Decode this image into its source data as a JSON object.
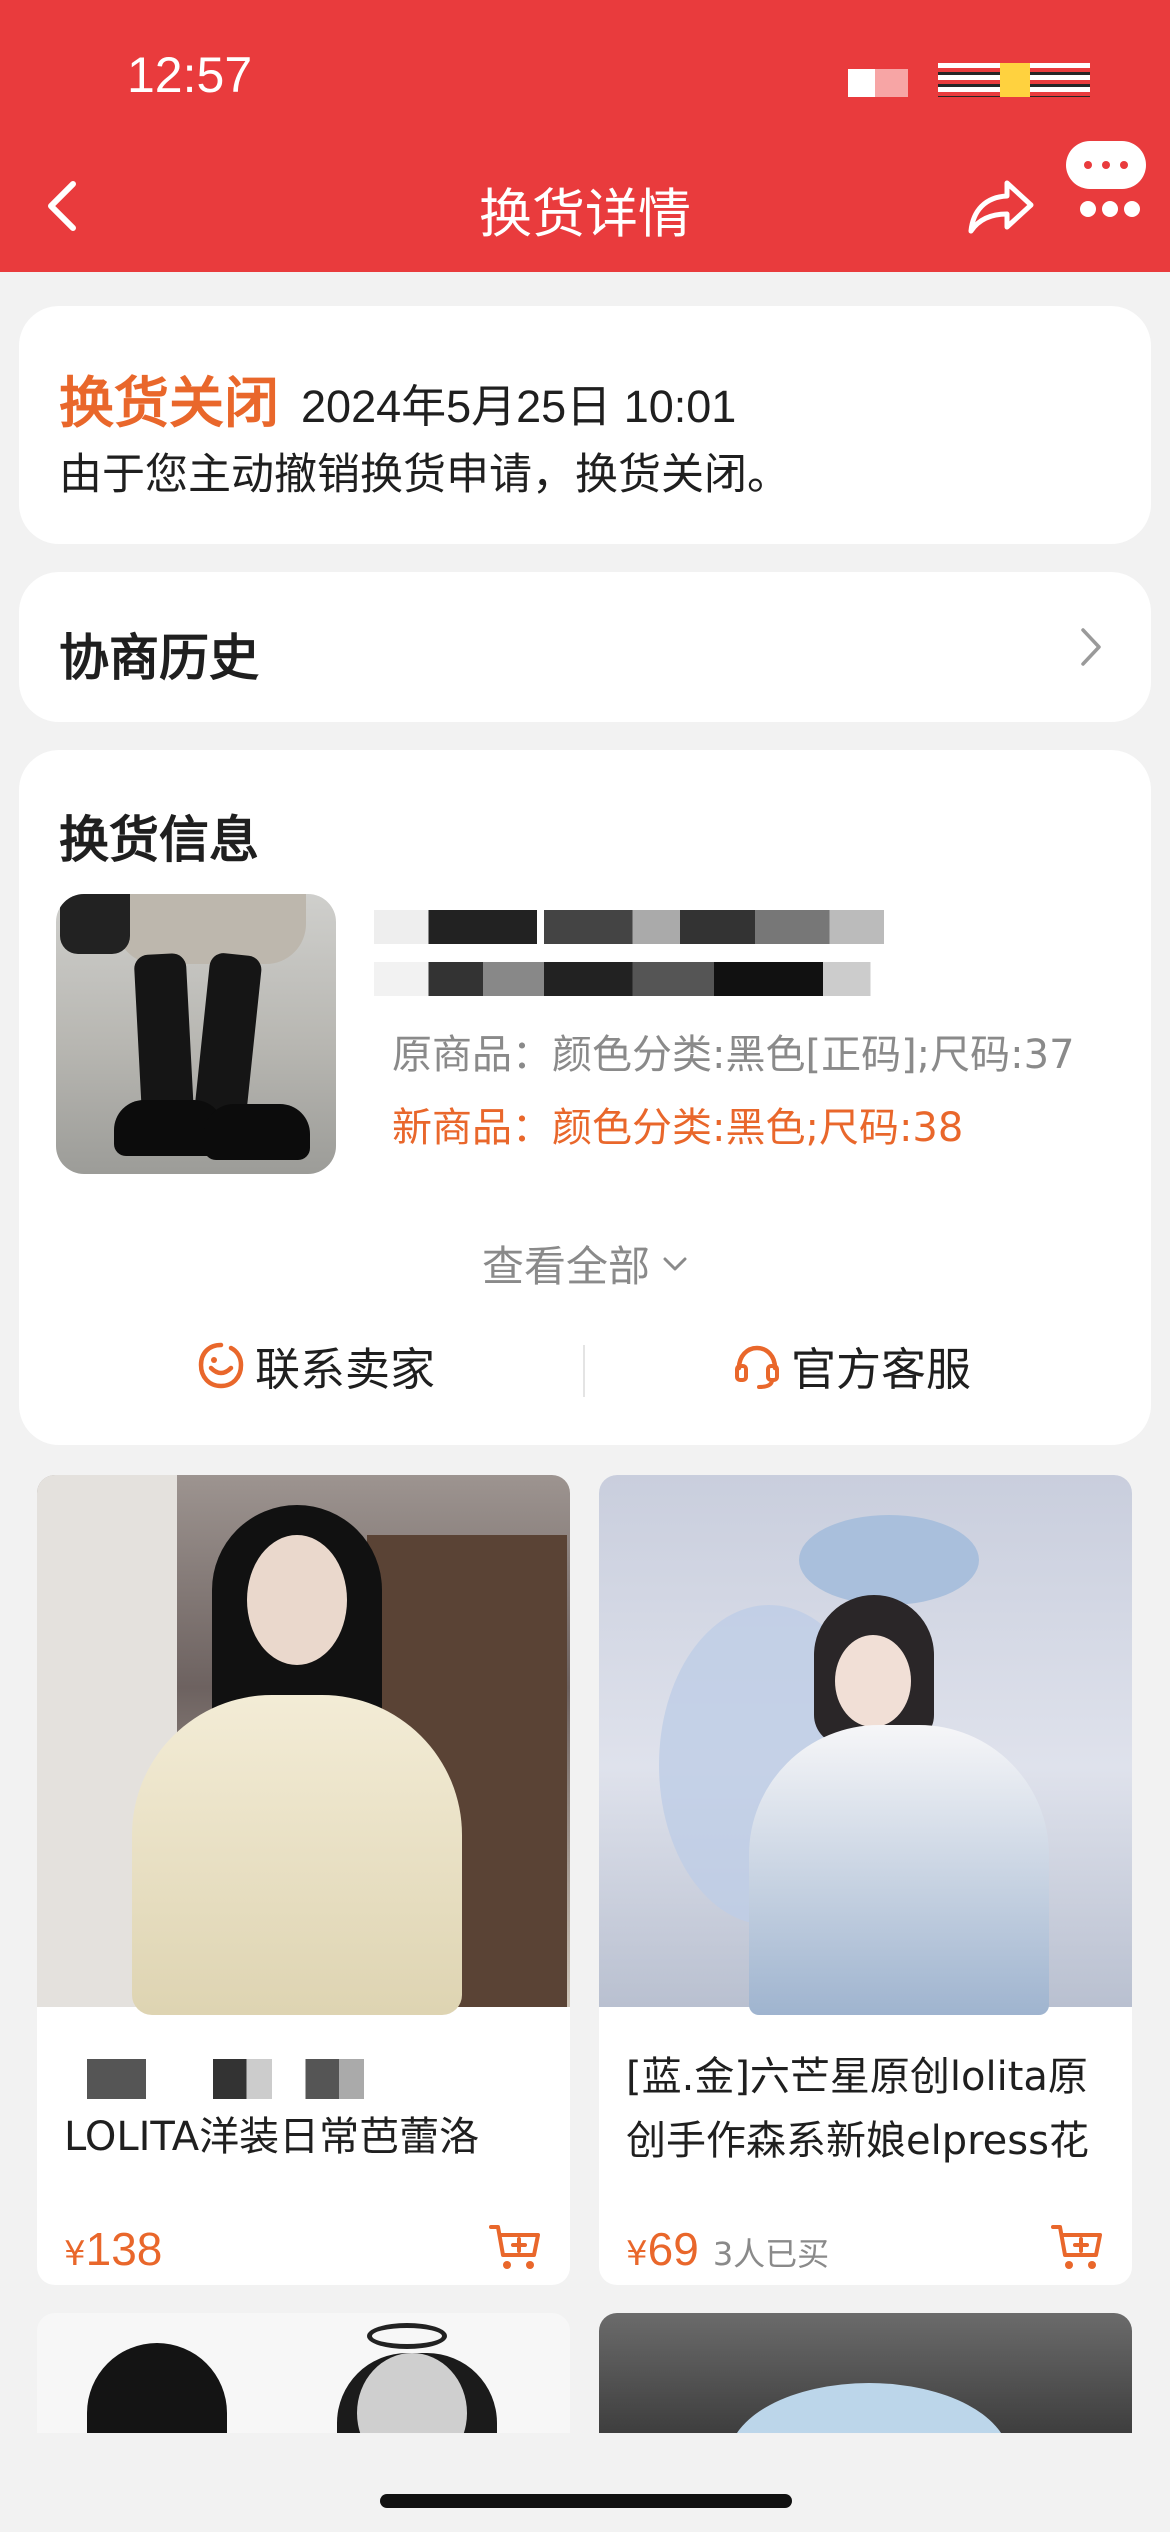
{
  "status_bar": {
    "time": "12:57"
  },
  "header": {
    "title": "换货详情",
    "back_icon": "chevron-left-icon",
    "share_icon": "share-icon",
    "message_icon": "message-icon",
    "background": "#e93b3d"
  },
  "exchange_status": {
    "label": "换货关闭",
    "datetime": "2024年5月25日 10:01",
    "description": "由于您主动撤销换货申请，换货关闭。"
  },
  "history": {
    "title": "协商历史"
  },
  "exchange_info": {
    "title": "换货信息",
    "original_item": "原商品：颜色分类:黑色[正码];尺码:37",
    "new_item": "新商品：颜色分类:黑色;尺码:38",
    "view_all": "查看全部",
    "contact_seller": "联系卖家",
    "official_service": "官方客服"
  },
  "recommendations": [
    {
      "title": "LOLITA洋装日常芭蕾洛",
      "currency": "¥",
      "price": "138",
      "sold": ""
    },
    {
      "title": "[蓝.金]六芒星原创lolita原创手作森系新娘elpress花",
      "currency": "¥",
      "price": "69",
      "sold": "3人已买"
    }
  ],
  "colors": {
    "accent": "#e9672b",
    "brand_red": "#e93b3d"
  }
}
